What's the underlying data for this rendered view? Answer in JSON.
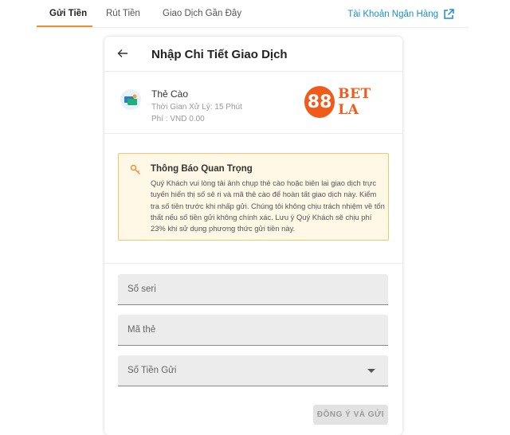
{
  "tabs": [
    {
      "label": "Gửi Tiền",
      "active": true
    },
    {
      "label": "Rút Tiền",
      "active": false
    },
    {
      "label": "Giao Dịch Gần Đây",
      "active": false
    }
  ],
  "bank_link": {
    "label": "Tài Khoản Ngân Hàng",
    "icon": "external-link-icon"
  },
  "card": {
    "title": "Nhập Chi Tiết Giao Dịch",
    "method": {
      "name": "Thẻ Cào",
      "processing_time": "Thời Gian Xử Lý: 15 Phút",
      "fee": "Phí : VND 0.00"
    },
    "logo": {
      "badge": "88",
      "text": "BET LA",
      "color": "#f05a1a"
    },
    "notice": {
      "title": "Thông Báo Quan Trọng",
      "body": "Quý Khách vui lòng tải ảnh chụp thẻ cào hoặc biên lai giao dịch trực tuyến hiển thị số sê ri và mã thẻ cào để hoàn tất giao dịch này. Kiểm tra số tiền trước khi nhấp gửi. Chúng tôi không chịu trách nhiệm về tổn thất nếu số tiền gửi không chính xác. Lưu ý Quý Khách sẽ chịu phí 23% khi sử dụng phương thức gửi tiền này.",
      "icon": "wrench-icon"
    },
    "fields": {
      "serial_placeholder": "Số seri",
      "code_placeholder": "Mã thẻ",
      "amount_placeholder": "Số Tiền Gửi"
    },
    "submit_label": "ĐỒNG Ý VÀ GỬI"
  },
  "colors": {
    "accent": "#e8913a",
    "link": "#1a8fd0",
    "notice_bg": "#fff8e6",
    "notice_border": "#f2c66d"
  }
}
